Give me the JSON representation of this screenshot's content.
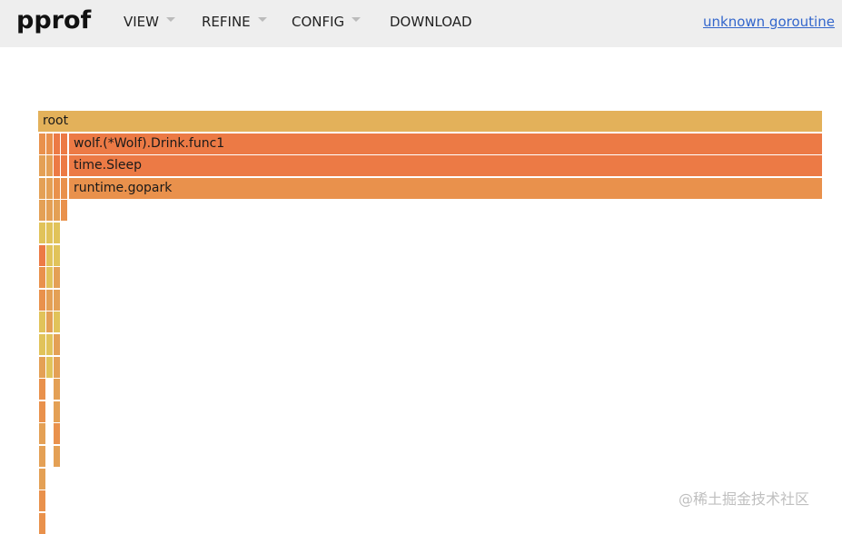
{
  "app": {
    "logo": "pprof",
    "menu": [
      {
        "label": "VIEW",
        "has_dropdown": true
      },
      {
        "label": "REFINE",
        "has_dropdown": true
      },
      {
        "label": "CONFIG",
        "has_dropdown": true
      },
      {
        "label": "DOWNLOAD",
        "has_dropdown": false
      }
    ],
    "profile_title": "unknown goroutine"
  },
  "flamegraph": {
    "root": "root",
    "frames": [
      {
        "label": "wolf.(*Wolf).Drink.func1",
        "depth": 1,
        "color": "#ec7a45"
      },
      {
        "label": "time.Sleep",
        "depth": 2,
        "color": "#ec7a45"
      },
      {
        "label": "runtime.gopark",
        "depth": 3,
        "color": "#e9914c"
      }
    ],
    "colors": {
      "root": "#e3b15a",
      "hot": "#ec7a45",
      "warm": "#e9914c",
      "mild": "#e4a055",
      "cool": "#e1c35a"
    }
  },
  "watermark": "@稀土掘金技术社区"
}
